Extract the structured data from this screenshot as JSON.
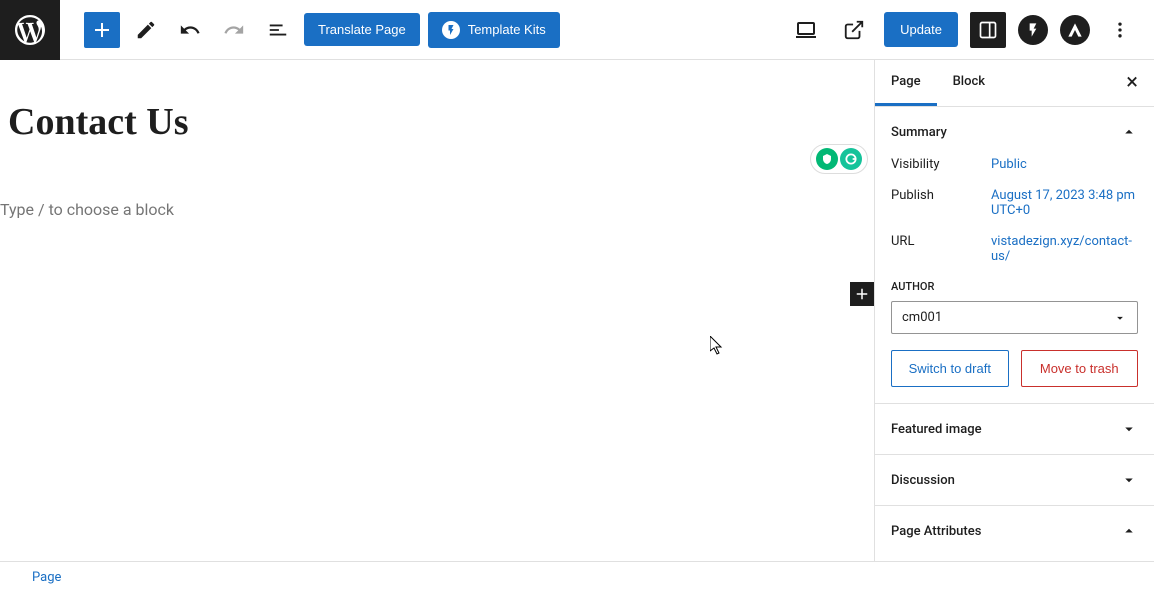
{
  "toolbar": {
    "translate_label": "Translate Page",
    "template_kits_label": "Template Kits",
    "update_label": "Update"
  },
  "editor": {
    "page_title": "Contact Us",
    "block_placeholder": "Type / to choose a block"
  },
  "sidebar": {
    "tabs": {
      "page": "Page",
      "block": "Block"
    },
    "panels": {
      "summary": {
        "title": "Summary",
        "visibility_label": "Visibility",
        "visibility_value": "Public",
        "publish_label": "Publish",
        "publish_value": "August 17, 2023 3:48 pm UTC+0",
        "url_label": "URL",
        "url_value": "vistadezign.xyz/contact-us/",
        "author_label": "AUTHOR",
        "author_value": "cm001",
        "switch_draft": "Switch to draft",
        "move_trash": "Move to trash"
      },
      "featured_image": "Featured image",
      "discussion": "Discussion",
      "page_attributes": "Page Attributes"
    }
  },
  "footer": {
    "breadcrumb": "Page"
  }
}
